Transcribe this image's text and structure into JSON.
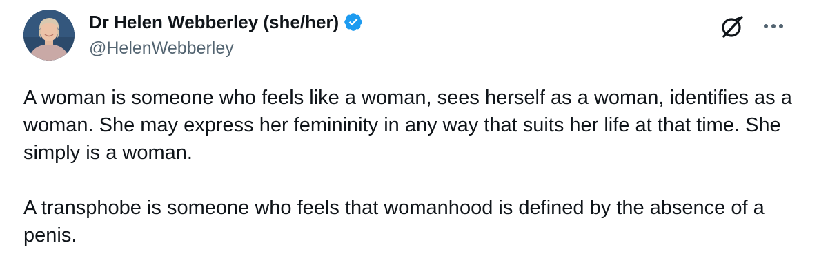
{
  "author": {
    "display_name": "Dr Helen Webberley (she/her)",
    "handle": "@HelenWebberley",
    "verified": true,
    "avatar_icon": "profile-photo"
  },
  "actions": {
    "grok_icon": "grok-icon",
    "more_icon": "more-dots-icon"
  },
  "tweet": {
    "paragraphs": [
      "A woman is someone who feels like a woman, sees herself as a woman, identifies as a woman. She may express her femininity in any way that suits her life at that time. She simply is a woman.",
      "A transphobe is someone who feels that womanhood is defined by the absence of a penis."
    ]
  },
  "colors": {
    "text": "#0f1419",
    "secondary_text": "#536471",
    "verified_blue": "#1d9bf0",
    "background": "#ffffff"
  }
}
